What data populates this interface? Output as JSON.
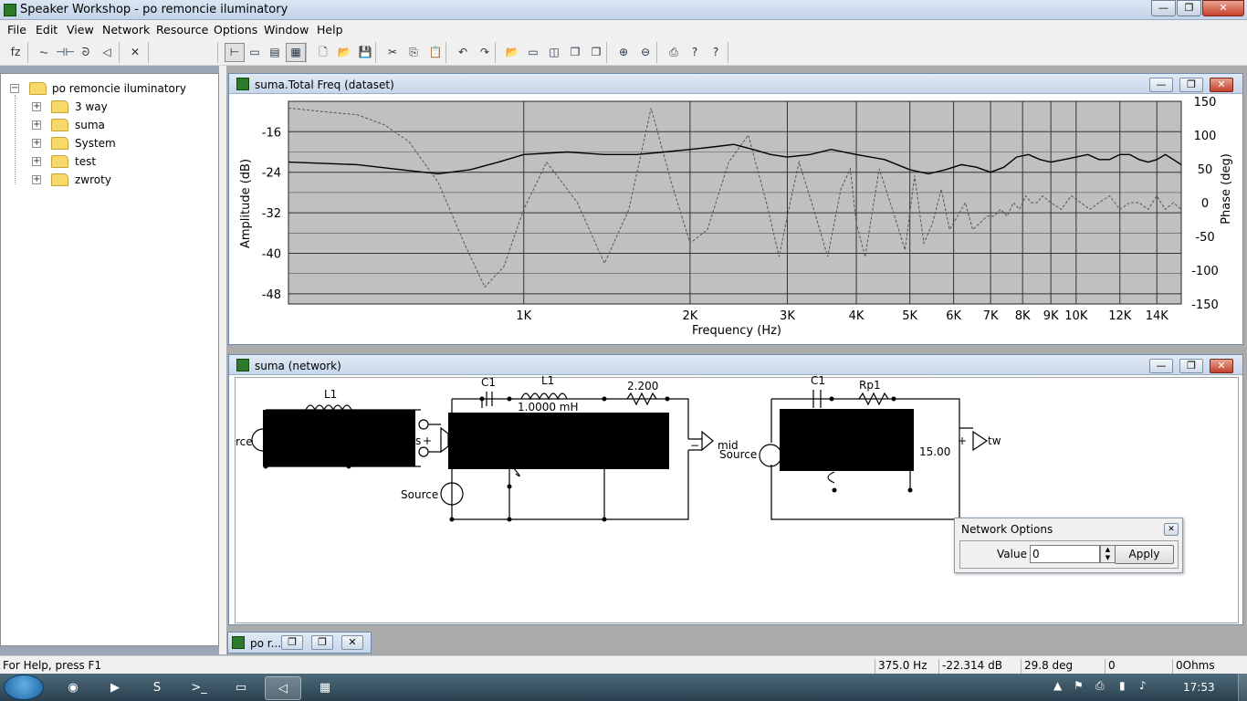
{
  "app": {
    "title": "Speaker Workshop - po remoncie iluminatory"
  },
  "window_controls": {
    "minimize": "—",
    "restore": "❐",
    "close": "✕"
  },
  "menu": [
    "File",
    "Edit",
    "View",
    "Network",
    "Resource",
    "Options",
    "Window",
    "Help"
  ],
  "toolbar": {
    "icons": [
      "function-icon",
      "resistor-icon",
      "capacitor-icon",
      "inductor-icon",
      "speaker-icon",
      "delete-icon",
      "select-icon",
      "view1-icon",
      "view2-icon",
      "view3-icon",
      "new-icon",
      "open-icon",
      "save-icon",
      "cut-icon",
      "copy-icon",
      "paste-icon",
      "undo-icon",
      "redo-icon",
      "open2-icon",
      "window-icon",
      "chart-icon",
      "stack1-icon",
      "stack2-icon",
      "zoom-in-icon",
      "zoom-out-icon",
      "print-icon",
      "help-icon",
      "context-help-icon"
    ],
    "glyphs": [
      "fz",
      "⏦",
      "⊣⊢",
      "ᘐ",
      "◁",
      "✕",
      "⊢",
      "▭",
      "▤",
      "▦",
      "🗋",
      "📂",
      "💾",
      "✂",
      "⎘",
      "📋",
      "↶",
      "↷",
      "📂",
      "▭",
      "◫",
      "❐",
      "❐",
      "⊕",
      "⊖",
      "⎙",
      "?",
      "?"
    ]
  },
  "tree": {
    "root": "po remoncie iluminatory",
    "root_expander": "−",
    "child_expander": "+",
    "children": [
      "3 way",
      "suma",
      "System",
      "test",
      "zwroty"
    ]
  },
  "chart_window": {
    "title": "suma.Total Freq (dataset)",
    "controls": {
      "minimize": "—",
      "restore": "❐",
      "close": "✕"
    }
  },
  "chart_data": {
    "type": "line",
    "xlabel": "Frequency (Hz)",
    "ylabel": "Amplitude (dB)",
    "y2label": "Phase (deg)",
    "x_scale": "log",
    "xlim": [
      375,
      15500
    ],
    "ylim": [
      -50,
      -10
    ],
    "y2lim": [
      -150,
      150
    ],
    "x_ticks": [
      {
        "v": 1000,
        "l": "1K"
      },
      {
        "v": 2000,
        "l": "2K"
      },
      {
        "v": 3000,
        "l": "3K"
      },
      {
        "v": 4000,
        "l": "4K"
      },
      {
        "v": 5000,
        "l": "5K"
      },
      {
        "v": 6000,
        "l": "6K"
      },
      {
        "v": 7000,
        "l": "7K"
      },
      {
        "v": 8000,
        "l": "8K"
      },
      {
        "v": 9000,
        "l": "9K"
      },
      {
        "v": 10000,
        "l": "10K"
      },
      {
        "v": 12000,
        "l": "12K"
      },
      {
        "v": 14000,
        "l": "14K"
      }
    ],
    "y_ticks": [
      -16,
      -24,
      -32,
      -40,
      -48
    ],
    "y2_ticks": [
      150,
      100,
      50,
      0,
      -50,
      -100,
      -150
    ],
    "grid": true,
    "series": [
      {
        "color": "#000000",
        "style": "solid",
        "x": [
          375,
          500,
          600,
          700,
          800,
          900,
          1000,
          1200,
          1400,
          1600,
          1800,
          2000,
          2200,
          2400,
          2600,
          2800,
          3000,
          3300,
          3600,
          4000,
          4500,
          5000,
          5400,
          5800,
          6200,
          6600,
          7000,
          7400,
          7800,
          8200,
          8600,
          9000,
          9500,
          10000,
          10500,
          11000,
          11500,
          12000,
          12500,
          13000,
          13500,
          14000,
          14500,
          15000,
          15500
        ],
        "y": [
          -22,
          -22.5,
          -23.5,
          -24.3,
          -23.5,
          -22,
          -20.5,
          -20,
          -20.5,
          -20.5,
          -20,
          -19.5,
          -19,
          -18.5,
          -19.5,
          -20.5,
          -21,
          -20.5,
          -19.5,
          -20.5,
          -21.5,
          -23.5,
          -24.3,
          -23.5,
          -22.5,
          -23,
          -24,
          -23,
          -21,
          -20.5,
          -21.5,
          -22,
          -21.5,
          -21,
          -20.5,
          -21.5,
          -21.5,
          -20.5,
          -20.5,
          -21.5,
          -22,
          -21.5,
          -20.5,
          -21.5,
          -22.5
        ]
      },
      {
        "color": "#555555",
        "style": "dashed",
        "axis": "phase",
        "x": [
          375,
          430,
          500,
          560,
          620,
          700,
          780,
          850,
          920,
          1000,
          1100,
          1250,
          1400,
          1550,
          1700,
          1850,
          2000,
          2150,
          2350,
          2550,
          2750,
          2900,
          3000,
          3150,
          3350,
          3550,
          3750,
          3900,
          4000,
          4150,
          4400,
          4650,
          4900,
          5100,
          5300,
          5500,
          5700,
          5900,
          6100,
          6300,
          6500,
          6700,
          6900,
          7100,
          7300,
          7500,
          7700,
          7900,
          8100,
          8300,
          8500,
          8700,
          9000,
          9400,
          9800,
          10200,
          10600,
          11000,
          11500,
          12000,
          12500,
          13000,
          13500,
          14000,
          14500,
          15000,
          15500
        ],
        "y": [
          140,
          135,
          130,
          115,
          90,
          30,
          -60,
          -125,
          -95,
          -10,
          60,
          0,
          -90,
          -10,
          140,
          30,
          -60,
          -40,
          60,
          100,
          0,
          -80,
          -20,
          60,
          -10,
          -80,
          20,
          50,
          -30,
          -80,
          50,
          -10,
          -70,
          40,
          -60,
          -30,
          20,
          -40,
          -20,
          0,
          -40,
          -30,
          -20,
          -20,
          -10,
          -20,
          0,
          -10,
          10,
          0,
          0,
          10,
          0,
          -10,
          10,
          0,
          -10,
          0,
          10,
          -10,
          0,
          0,
          -10,
          10,
          -10,
          0,
          -10
        ]
      }
    ]
  },
  "network_window": {
    "title": "suma (network)",
    "controls": {
      "minimize": "—",
      "restore": "❐",
      "close": "✕"
    },
    "labels": {
      "l1": "L1",
      "c1a": "C1",
      "l1b": "L1",
      "r2": "2.200",
      "inductance": "1.0000 mH",
      "mid": "mid",
      "source_left": "rce",
      "source_mid": "Source",
      "source_right": "Source",
      "c1b": "C1",
      "rp1": "Rp1",
      "r15": "15.00",
      "tw": "tw",
      "plus_a": "+",
      "plus_b": "+",
      "minus": "−",
      "ss": "s"
    }
  },
  "minimized_window": {
    "title": "po r..."
  },
  "network_options": {
    "title": "Network Options",
    "value_label": "Value",
    "value": "0",
    "apply": "Apply",
    "close": "✕"
  },
  "status": {
    "help": "For Help, press F1",
    "freq": "375.0 Hz",
    "db": "-22.314 dB",
    "deg": "29.8 deg",
    "field4": "0",
    "ohms": "0Ohms"
  },
  "taskbar": {
    "time": "17:53",
    "apps": [
      {
        "icon": "chrome-icon",
        "glyph": "◉"
      },
      {
        "icon": "media-player-icon",
        "glyph": "▶"
      },
      {
        "icon": "skype-icon",
        "glyph": "S"
      },
      {
        "icon": "console-icon",
        "glyph": ">_"
      },
      {
        "icon": "explorer-icon",
        "glyph": "▭"
      },
      {
        "icon": "speaker-workshop-icon",
        "glyph": "◁"
      },
      {
        "icon": "calculator-icon",
        "glyph": "▦"
      }
    ],
    "tray": [
      "▲",
      "⚑",
      "⎙",
      "▮",
      "♪"
    ]
  }
}
